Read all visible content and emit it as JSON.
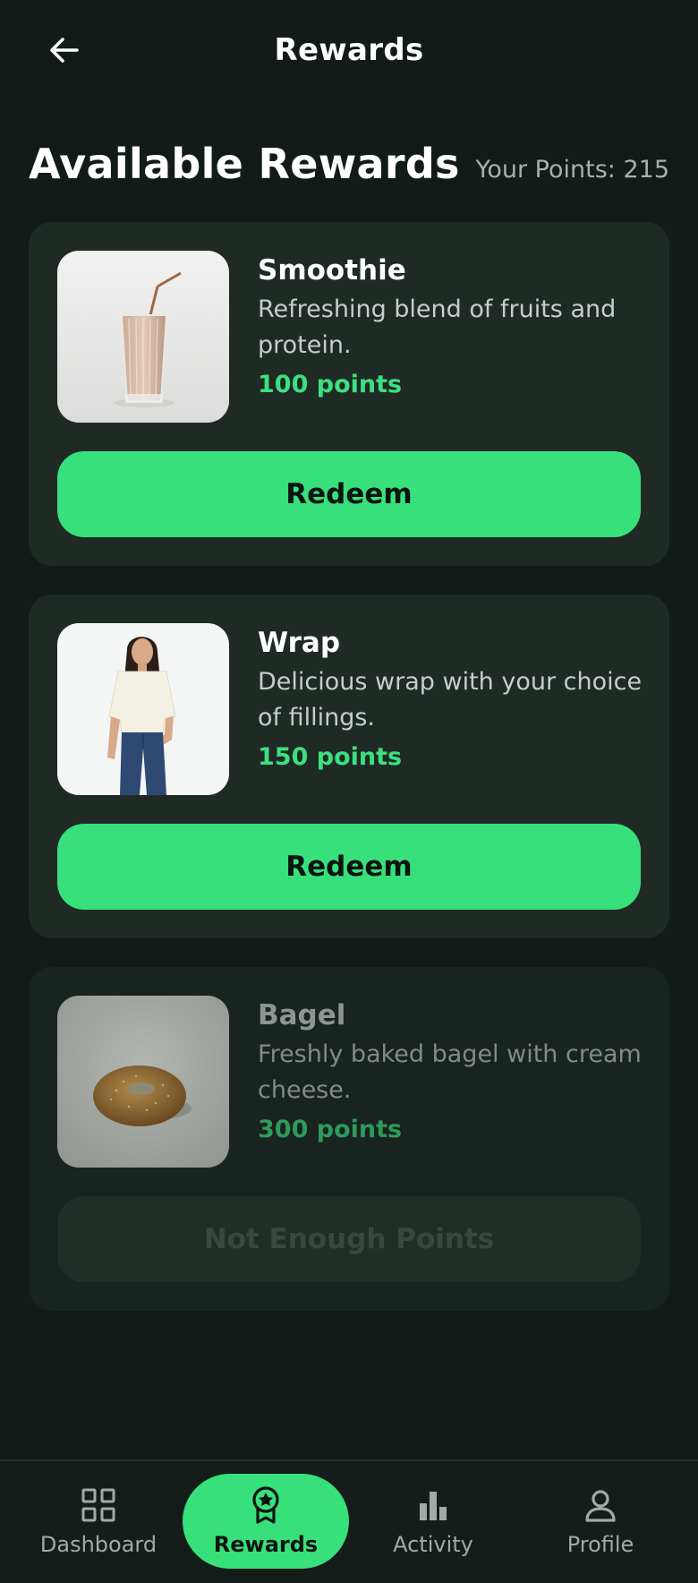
{
  "header": {
    "title": "Rewards",
    "back_icon": "arrow-left-icon"
  },
  "main": {
    "heading": "Available Rewards",
    "points_balance": "Your Points: 215"
  },
  "rewards": [
    {
      "name": "Smoothie",
      "description": "Refreshing blend of fruits and protein.",
      "cost": "100 points",
      "button_label": "Redeem",
      "enabled": true
    },
    {
      "name": "Wrap",
      "description": "Delicious wrap with your choice of fillings.",
      "cost": "150 points",
      "button_label": "Redeem",
      "enabled": true
    },
    {
      "name": "Bagel",
      "description": "Freshly baked bagel with cream cheese.",
      "cost": "300 points",
      "button_label": "Not Enough Points",
      "enabled": false
    }
  ],
  "nav": {
    "items": [
      {
        "label": "Dashboard",
        "icon": "grid-icon",
        "active": false
      },
      {
        "label": "Rewards",
        "icon": "award-icon",
        "active": true
      },
      {
        "label": "Activity",
        "icon": "bar-chart-icon",
        "active": false
      },
      {
        "label": "Profile",
        "icon": "user-icon",
        "active": false
      }
    ]
  },
  "colors": {
    "background": "#121b17",
    "card": "#1f2a25",
    "accent": "#38e07c",
    "points_text": "#3de07f"
  }
}
